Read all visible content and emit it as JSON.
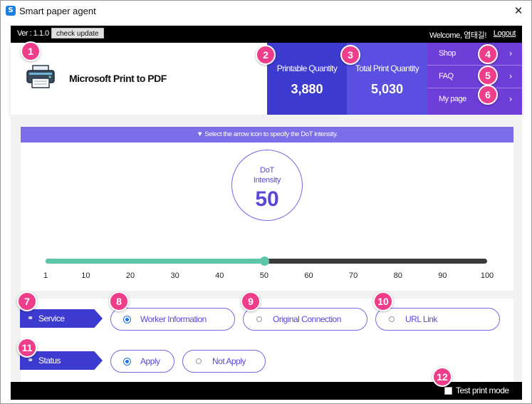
{
  "window": {
    "title": "Smart paper agent",
    "app_icon": "S",
    "close_glyph": "✕"
  },
  "topbar": {
    "version": "Ver : 1.1.0",
    "check_update": "check update",
    "welcome": "Welcome, 염태길!",
    "logout": "Logout"
  },
  "printer": {
    "name": "Microsoft Print to PDF",
    "icon": "printer-icon"
  },
  "quantities": {
    "printable_label": "Printable Quantity",
    "printable_value": "3,880",
    "total_label": "Total Print Quantity",
    "total_value": "5,030"
  },
  "side_menu": [
    {
      "label": "Shop",
      "chevron": "›"
    },
    {
      "label": "FAQ",
      "chevron": "›"
    },
    {
      "label": "My page",
      "chevron": "›"
    }
  ],
  "dot": {
    "banner": "▼ Select the arrow icon to specify the DoT intensity.",
    "title_line1": "DoT",
    "title_line2": "Intensity",
    "value": "50"
  },
  "slider": {
    "min": 1,
    "max": 100,
    "value": 50,
    "ticks": [
      "1",
      "10",
      "20",
      "30",
      "40",
      "50",
      "60",
      "70",
      "80",
      "90",
      "100"
    ]
  },
  "service": {
    "label": "Service",
    "icon": "link-icon",
    "options": [
      {
        "label": "Worker Information",
        "checked": true
      },
      {
        "label": "Original Connection",
        "checked": false
      },
      {
        "label": "URL Link",
        "checked": false
      }
    ]
  },
  "status": {
    "label": "Status",
    "icon": "link-icon",
    "options": [
      {
        "label": "Apply",
        "checked": true
      },
      {
        "label": "Not Apply",
        "checked": false
      }
    ]
  },
  "bottombar": {
    "test_mode": "Test print mode",
    "test_checked": false
  },
  "markers": [
    "1",
    "2",
    "3",
    "4",
    "5",
    "6",
    "7",
    "8",
    "9",
    "10",
    "11",
    "12"
  ],
  "colors": {
    "primary": "#3d3ad0",
    "secondary": "#5a4fe0",
    "menu": "#6e3ed8",
    "accent": "#7a66e6",
    "slider": "#5ec6a8",
    "marker": "#ee3d8a"
  }
}
